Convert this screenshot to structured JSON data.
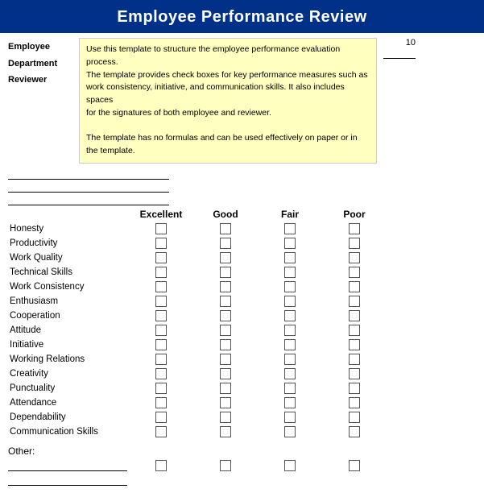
{
  "header": {
    "title": "Employee Performance Review"
  },
  "info": {
    "employee_label": "Employee",
    "department_label": "Department",
    "reviewer_label": "Reviewer",
    "date_label": "10"
  },
  "tooltip": {
    "line1": "Use this template to structure the employee performance evaluation process.",
    "line2": "The template provides check boxes for key performance measures such as",
    "line3": "work consistency, initiative, and communication skills. It also includes spaces",
    "line4": "for the signatures of both employee and reviewer.",
    "line5": "",
    "line6": "The template has no formulas and can be used effectively on paper or in the template."
  },
  "columns": {
    "excellent": "Excellent",
    "good": "Good",
    "fair": "Fair",
    "poor": "Poor"
  },
  "criteria": [
    "Honesty",
    "Productivity",
    "Work Quality",
    "Technical Skills",
    "Work Consistency",
    "Enthusiasm",
    "Cooperation",
    "Attitude",
    "Initiative",
    "Working Relations",
    "Creativity",
    "Punctuality",
    "Attendance",
    "Dependability",
    "Communication Skills"
  ],
  "other": {
    "label": "Other:"
  }
}
